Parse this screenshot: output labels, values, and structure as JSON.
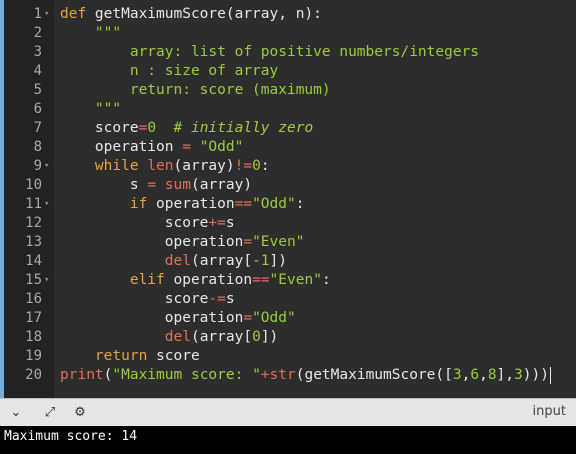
{
  "editor": {
    "line_numbers": [
      "1",
      "2",
      "3",
      "4",
      "5",
      "6",
      "7",
      "8",
      "9",
      "10",
      "11",
      "12",
      "13",
      "14",
      "15",
      "16",
      "17",
      "18",
      "19",
      "20"
    ],
    "lines": [
      [
        {
          "t": "def ",
          "c": "kw"
        },
        {
          "t": "getMaximumScore(array, n):",
          "c": "fn"
        }
      ],
      [
        {
          "t": "    \"\"\"",
          "c": "str"
        }
      ],
      [
        {
          "t": "        array: list of positive numbers/integers",
          "c": "str"
        }
      ],
      [
        {
          "t": "        n : size of array",
          "c": "str"
        }
      ],
      [
        {
          "t": "        return: score (maximum)",
          "c": "str"
        }
      ],
      [
        {
          "t": "    \"\"\"",
          "c": "str"
        }
      ],
      [
        {
          "t": "    score",
          "c": "fn"
        },
        {
          "t": "=",
          "c": "op"
        },
        {
          "t": "0",
          "c": "num"
        },
        {
          "t": "  # initially zero",
          "c": "cm"
        }
      ],
      [
        {
          "t": "    operation ",
          "c": "fn"
        },
        {
          "t": "=",
          "c": "op"
        },
        {
          "t": " ",
          "c": "fn"
        },
        {
          "t": "\"Odd\"",
          "c": "str"
        }
      ],
      [
        {
          "t": "    while ",
          "c": "kw"
        },
        {
          "t": "len",
          "c": "bi"
        },
        {
          "t": "(array)",
          "c": "fn"
        },
        {
          "t": "!=",
          "c": "op"
        },
        {
          "t": "0",
          "c": "num"
        },
        {
          "t": ":",
          "c": "fn"
        }
      ],
      [
        {
          "t": "        s ",
          "c": "fn"
        },
        {
          "t": "=",
          "c": "op"
        },
        {
          "t": " ",
          "c": "fn"
        },
        {
          "t": "sum",
          "c": "bi"
        },
        {
          "t": "(array)",
          "c": "fn"
        }
      ],
      [
        {
          "t": "        if ",
          "c": "kw"
        },
        {
          "t": "operation",
          "c": "fn"
        },
        {
          "t": "==",
          "c": "op"
        },
        {
          "t": "\"Odd\"",
          "c": "str"
        },
        {
          "t": ":",
          "c": "fn"
        }
      ],
      [
        {
          "t": "            score",
          "c": "fn"
        },
        {
          "t": "+=",
          "c": "op"
        },
        {
          "t": "s",
          "c": "fn"
        }
      ],
      [
        {
          "t": "            operation",
          "c": "fn"
        },
        {
          "t": "=",
          "c": "op"
        },
        {
          "t": "\"Even\"",
          "c": "str"
        }
      ],
      [
        {
          "t": "            ",
          "c": "fn"
        },
        {
          "t": "del",
          "c": "bi"
        },
        {
          "t": "(array[",
          "c": "fn"
        },
        {
          "t": "-1",
          "c": "num"
        },
        {
          "t": "])",
          "c": "fn"
        }
      ],
      [
        {
          "t": "        elif ",
          "c": "kw"
        },
        {
          "t": "operation",
          "c": "fn"
        },
        {
          "t": "==",
          "c": "op"
        },
        {
          "t": "\"Even\"",
          "c": "str"
        },
        {
          "t": ":",
          "c": "fn"
        }
      ],
      [
        {
          "t": "            score",
          "c": "fn"
        },
        {
          "t": "-=",
          "c": "op"
        },
        {
          "t": "s",
          "c": "fn"
        }
      ],
      [
        {
          "t": "            operation",
          "c": "fn"
        },
        {
          "t": "=",
          "c": "op"
        },
        {
          "t": "\"Odd\"",
          "c": "str"
        }
      ],
      [
        {
          "t": "            ",
          "c": "fn"
        },
        {
          "t": "del",
          "c": "bi"
        },
        {
          "t": "(array[",
          "c": "fn"
        },
        {
          "t": "0",
          "c": "num"
        },
        {
          "t": "])",
          "c": "fn"
        }
      ],
      [
        {
          "t": "    return ",
          "c": "kw"
        },
        {
          "t": "score",
          "c": "fn"
        }
      ],
      [
        {
          "t": "print",
          "c": "bi"
        },
        {
          "t": "(",
          "c": "fn"
        },
        {
          "t": "\"Maximum score: \"",
          "c": "str"
        },
        {
          "t": "+",
          "c": "op"
        },
        {
          "t": "str",
          "c": "bi"
        },
        {
          "t": "(getMaximumScore([",
          "c": "fn"
        },
        {
          "t": "3",
          "c": "num"
        },
        {
          "t": ",",
          "c": "fn"
        },
        {
          "t": "6",
          "c": "num"
        },
        {
          "t": ",",
          "c": "fn"
        },
        {
          "t": "8",
          "c": "num"
        },
        {
          "t": "],",
          "c": "fn"
        },
        {
          "t": "3",
          "c": "num"
        },
        {
          "t": ")))",
          "c": "fn"
        }
      ]
    ],
    "foldable_lines": [
      "1",
      "9",
      "11",
      "15"
    ]
  },
  "toolbar": {
    "icons": [
      "chevron-down-icon",
      "expand-icon",
      "settings-icon"
    ],
    "glyphs": [
      "⌄",
      "⤢",
      "⚙"
    ],
    "input_label": "input"
  },
  "output": {
    "text": "Maximum score: 14"
  },
  "colors": {
    "keyword": "#e8a33b",
    "string": "#9ccc3a",
    "builtin": "#e86a5a",
    "text": "#e6e6e6",
    "background": "#2d2d2d"
  }
}
